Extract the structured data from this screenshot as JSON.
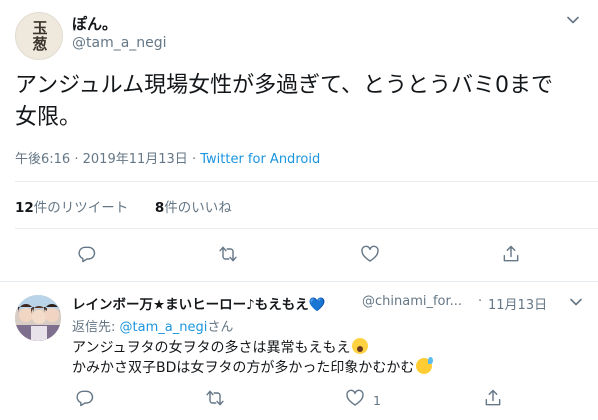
{
  "tweet": {
    "author": {
      "avatar_text": "玉葱",
      "display_name": "ぽん。",
      "handle": "@tam_a_negi"
    },
    "text": "アンジュルム現場女性が多過ぎて、とうとうバミ0まで\n女限。",
    "time": "午後6:16",
    "separator": "·",
    "date": "2019年11月13日",
    "source": "Twitter for Android",
    "stats": {
      "retweet_count": "12",
      "retweet_label": "件のリツイート",
      "like_count": "8",
      "like_label": "件のいいね"
    },
    "actions": [
      "reply-icon",
      "retweet-icon",
      "like-icon",
      "share-icon"
    ]
  },
  "reply": {
    "author": {
      "display_name": "レインボー万★まいヒーロー♪もえもえ",
      "name_emoji": "💙",
      "handle": "@chinami_for...",
      "separator": "·",
      "date": "11月13日"
    },
    "reply_to": {
      "prefix": "返信先:",
      "handle": "@tam_a_negi",
      "suffix": "さん"
    },
    "line1": "アンジュヲタの女ヲタの多さは異常もえもえ",
    "line2": "かみかさ双子BDは女ヲタの方が多かった印象かむかむ",
    "actions": {
      "reply_count": "",
      "retweet_count": "",
      "like_count": "1",
      "share_count": ""
    }
  },
  "colors": {
    "link": "#1b95e0",
    "secondary_text": "#657786",
    "primary_text": "#14171a",
    "divider": "#e6ecf0",
    "heart_blue": "#5aa3e6"
  }
}
